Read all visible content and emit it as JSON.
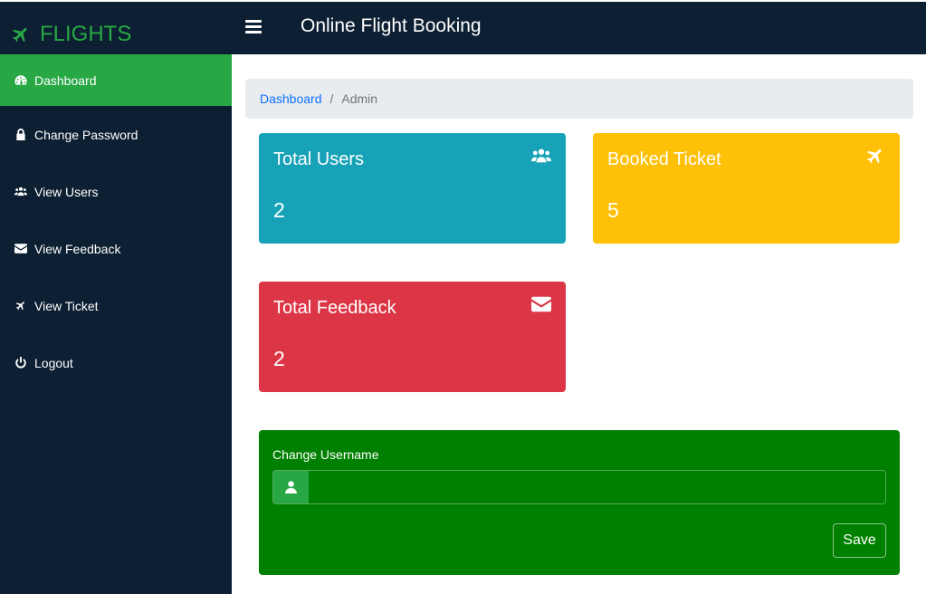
{
  "brand": {
    "name": "FLIGHTS",
    "icon": "plane-icon",
    "color": "#28a745"
  },
  "header": {
    "title": "Online Flight Booking",
    "menu_icon": "hamburger-menu-icon"
  },
  "sidebar": {
    "items": [
      {
        "label": "Dashboard",
        "icon": "dashboard-icon",
        "active": true
      },
      {
        "label": "Change Password",
        "icon": "lock-icon"
      },
      {
        "label": "View Users",
        "icon": "users-icon"
      },
      {
        "label": "View Feedback",
        "icon": "envelope-icon"
      },
      {
        "label": "View Ticket",
        "icon": "plane-icon"
      },
      {
        "label": "Logout",
        "icon": "power-icon"
      }
    ]
  },
  "breadcrumb": {
    "link": "Dashboard",
    "separator": "/",
    "current": "Admin"
  },
  "cards": [
    {
      "title": "Total Users",
      "value": "2",
      "icon": "users-icon",
      "color": "#17a2b8"
    },
    {
      "title": "Booked Ticket",
      "value": "5",
      "icon": "plane-icon",
      "color": "#ffc107"
    },
    {
      "title": "Total Feedback",
      "value": "2",
      "icon": "envelope-icon",
      "color": "#dc3545"
    }
  ],
  "form": {
    "label": "Change Username",
    "input_value": "",
    "input_icon": "user-icon",
    "save_label": "Save",
    "background": "#008000"
  }
}
